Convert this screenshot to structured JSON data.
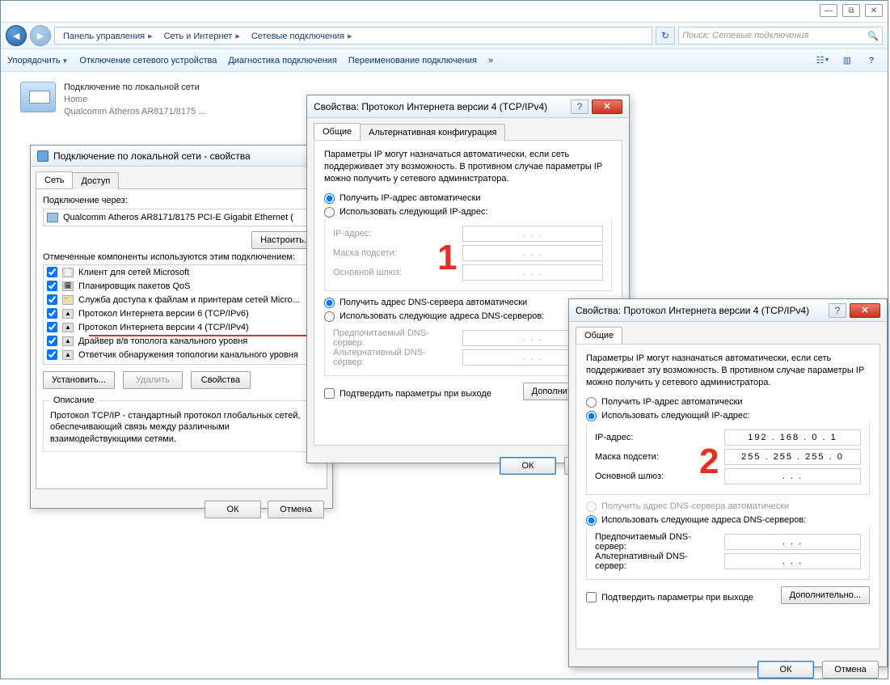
{
  "win_controls": {
    "min": "—",
    "max": "⧉",
    "close": "✕"
  },
  "breadcrumb": {
    "root_icon": "▤",
    "seg1": "Панель управления",
    "seg2": "Сеть и Интернет",
    "seg3": "Сетевые подключения",
    "arrow": "▸"
  },
  "search": {
    "placeholder": "Поиск: Сетевые подключения"
  },
  "toolbar": {
    "organize": "Упорядочить",
    "disable": "Отключение сетевого устройства",
    "diagnose": "Диагностика подключения",
    "rename": "Переименование подключения",
    "more": "»"
  },
  "connection": {
    "name": "Подключение по локальной сети",
    "status": "Home",
    "adapter": "Qualcomm Atheros AR8171/8175 ..."
  },
  "props_dlg": {
    "title": "Подключение по локальной сети - свойства",
    "tab_net": "Сеть",
    "tab_access": "Доступ",
    "connect_via": "Подключение через:",
    "adapter": "Qualcomm Atheros AR8171/8175 PCI-E Gigabit Ethernet (",
    "configure": "Настроить...",
    "components_label": "Отмеченные компоненты используются этим подключением:",
    "items": [
      "Клиент для сетей Microsoft",
      "Планировщик пакетов QoS",
      "Служба доступа к файлам и принтерам сетей Micro...",
      "Протокол Интернета версии 6 (TCP/IPv6)",
      "Протокол Интернета версии 4 (TCP/IPv4)",
      "Драйвер в/в тополога канального уровня",
      "Ответчик обнаружения топологии канального уровня"
    ],
    "install": "Установить...",
    "uninstall": "Удалить",
    "properties": "Свойства",
    "desc_label": "Описание",
    "desc_text": "Протокол TCP/IP - стандартный протокол глобальных сетей, обеспечивающий связь между различными взаимодействующими сетями.",
    "ok": "ОК",
    "cancel": "Отмена"
  },
  "ipv4": {
    "title": "Свойства: Протокол Интернета версии 4 (TCP/IPv4)",
    "tab_general": "Общие",
    "tab_alt": "Альтернативная конфигурация",
    "info": "Параметры IP могут назначаться автоматически, если сеть поддерживает эту возможность. В противном случае параметры IP можно получить у сетевого администратора.",
    "radio_ip_auto": "Получить IP-адрес автоматически",
    "radio_ip_manual": "Использовать следующий IP-адрес:",
    "lbl_ip": "IP-адрес:",
    "lbl_mask": "Маска подсети:",
    "lbl_gw": "Основной шлюз:",
    "radio_dns_auto": "Получить адрес DNS-сервера автоматически",
    "radio_dns_manual": "Использовать следующие адреса DNS-серверов:",
    "lbl_dns1": "Предпочитаемый DNS-сервер:",
    "lbl_dns2": "Альтернативный DNS-сервер:",
    "chk_validate": "Подтвердить параметры при выходе",
    "btn_more": "Дополнительно...",
    "ok": "ОК",
    "cancel": "Отмена",
    "marker1": "1",
    "marker2": "2",
    "ip_val": "192 . 168 .  0  .  1",
    "mask_val": "255 . 255 . 255 .  0",
    "dots": ".     .     ."
  }
}
